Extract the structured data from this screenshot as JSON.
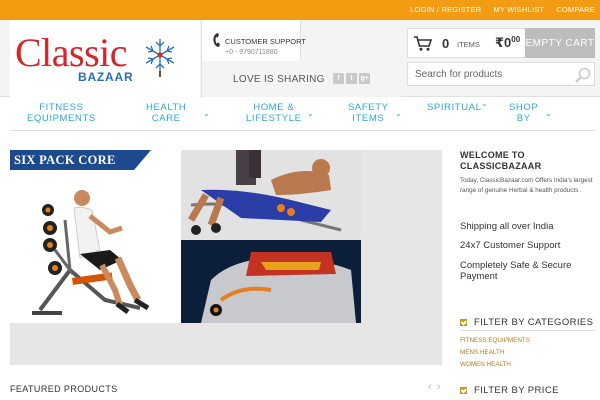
{
  "topbar": {
    "links": [
      "LOGIN / REGISTER",
      "MY WISHLIST",
      "COMPARE"
    ]
  },
  "logo": {
    "word1": "Classic",
    "word2": "BAZAAR"
  },
  "support": {
    "title": "CUSTOMER SUPPORT",
    "phone": "+0 - 9790711880"
  },
  "sharing": {
    "text": "LOVE IS SHARING",
    "icons": [
      "f",
      "t",
      "g+"
    ]
  },
  "cart": {
    "count": "0",
    "items_label": "ITEMS",
    "total": "₹0",
    "total_cents": "00",
    "empty_label": "EMPTY CART"
  },
  "search": {
    "placeholder": "Search for products"
  },
  "nav": {
    "items": [
      {
        "line1": "FITNESS",
        "line2": "EQUIPMENTS",
        "has_chevron": false
      },
      {
        "line1": "HEALTH",
        "line2": "CARE",
        "has_chevron": true
      },
      {
        "line1": "HOME &",
        "line2": "LIFESTYLE",
        "has_chevron": true
      },
      {
        "line1": "SAFETY",
        "line2": "ITEMS",
        "has_chevron": true
      },
      {
        "line1": "SPIRITUAL",
        "line2": "",
        "has_chevron": true
      },
      {
        "line1": "SHOP",
        "line2": "BY",
        "has_chevron": true
      }
    ]
  },
  "banner": {
    "headline": "SIX PACK CORE"
  },
  "sidebar": {
    "welcome_line1": "WELCOME TO",
    "welcome_line2": "CLASSICBAZAAR",
    "welcome_text": "Today, ClassicBazaar.com Offers India's largest range of genuine Herbal & health products .",
    "features": [
      "Shipping all over India",
      "24x7 Customer Support",
      "Completely Safe & Secure",
      "Payment"
    ],
    "filter_categories_title": "FILTER BY CATEGORIES",
    "categories": [
      "FITNESS EQUIPMENTS",
      "MENS HEALTH",
      "WOMEN HEALTH"
    ],
    "filter_price_title": "FILTER BY PRICE"
  },
  "featured": {
    "title": "FEATURED PRODUCTS",
    "prev": "‹",
    "next": "›"
  },
  "colors": {
    "topbar": "#f39c12",
    "nav_text": "#2aa9d3",
    "logo_red": "#d6262b",
    "logo_blue": "#2a6db3",
    "banner_tag": "#1d4a8c",
    "category_link": "#c47b00"
  }
}
